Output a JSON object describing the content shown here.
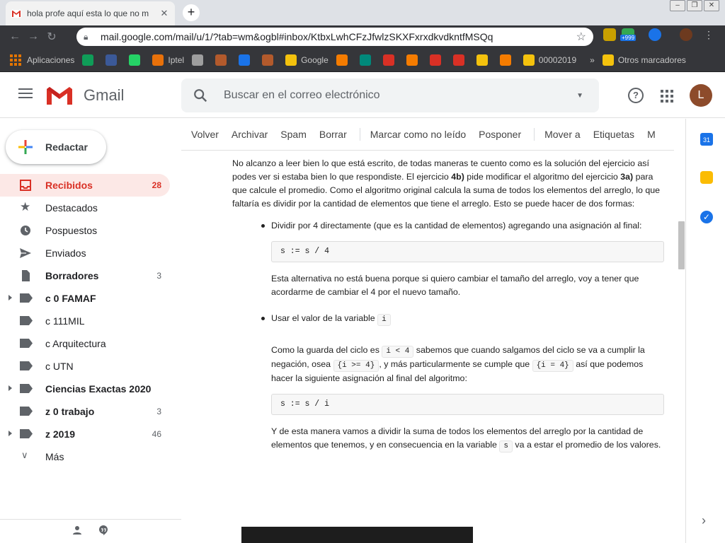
{
  "browser": {
    "tab_title": "hola profe aquí esta lo que no m",
    "tab_close": "✕",
    "new_tab": "+",
    "url": "mail.google.com/mail/u/1/?tab=wm&ogbl#inbox/KtbxLwhCFzJfwlzSKXFxrxdkvdkntfMSQq",
    "ext_badge": "+999",
    "bookmarks": [
      {
        "label": "Aplicaciones",
        "color": "#e37400"
      },
      {
        "label": "",
        "color": "#0f9d58"
      },
      {
        "label": "",
        "color": "#3b5998"
      },
      {
        "label": "",
        "color": "#25d366"
      },
      {
        "label": "Iptel",
        "color": "#e8710a"
      },
      {
        "label": "",
        "color": "#9e9e9e"
      },
      {
        "label": "",
        "color": "#b35a2c"
      },
      {
        "label": "",
        "color": "#1a73e8"
      },
      {
        "label": "",
        "color": "#b35a2c"
      },
      {
        "label": "Google",
        "color": "#f4c20d"
      },
      {
        "label": "",
        "color": "#f57c00"
      },
      {
        "label": "",
        "color": "#00897b"
      },
      {
        "label": "",
        "color": "#d93025"
      },
      {
        "label": "",
        "color": "#f57c00"
      },
      {
        "label": "",
        "color": "#d93025"
      },
      {
        "label": "",
        "color": "#d93025"
      },
      {
        "label": "",
        "color": "#f4c20d"
      },
      {
        "label": "",
        "color": "#f57c00"
      },
      {
        "label": "00002019",
        "color": "#f4c20d"
      }
    ],
    "bookmarks_more": "»",
    "other_bookmarks": "Otros marcadores"
  },
  "gmail": {
    "brand": "Gmail",
    "search_placeholder": "Buscar en el correo electrónico",
    "help": "?",
    "avatar_initial": "L",
    "compose": "Redactar",
    "nav": [
      {
        "label": "Recibidos",
        "count": "28"
      },
      {
        "label": "Destacados",
        "count": ""
      },
      {
        "label": "Pospuestos",
        "count": ""
      },
      {
        "label": "Enviados",
        "count": ""
      },
      {
        "label": "Borradores",
        "count": "3"
      },
      {
        "label": "c 0 FAMAF",
        "count": ""
      },
      {
        "label": "c 111MIL",
        "count": ""
      },
      {
        "label": "c Arquitectura",
        "count": ""
      },
      {
        "label": "c UTN",
        "count": ""
      },
      {
        "label": "Ciencias Exactas 2020",
        "count": ""
      },
      {
        "label": "z 0 trabajo",
        "count": "3"
      },
      {
        "label": "z 2019",
        "count": "46"
      },
      {
        "label": "Más",
        "count": ""
      }
    ],
    "actions": [
      "Volver",
      "Archivar",
      "Spam",
      "Borrar",
      "Marcar como no leído",
      "Posponer",
      "Mover a",
      "Etiquetas",
      "M"
    ],
    "side_apps": {
      "calendar_day": "31"
    }
  },
  "message": {
    "intro_a": "No alcanzo a leer bien lo que está escrito, de todas maneras te cuento como es la solución del ejercicio así podes ver si estaba bien lo que respondiste. El ejercicio ",
    "intro_b1": "4b)",
    "intro_c": " pide modificar el algoritmo del ejercicio ",
    "intro_b2": "3a)",
    "intro_d": " para que calcule el promedio. Como el algoritmo original calcula la suma de todos los elementos del arreglo, lo que faltaría es dividir por la cantidad de elementos que tiene el arreglo. Esto se puede hacer de dos formas:",
    "bullet1": "Dividir por 4 directamente (que es la cantidad de elementos) agregando una asignación al final:",
    "code1": "s := s / 4",
    "after1": "Esta alternativa no está buena porque si quiero cambiar el tamaño del arreglo, voy a tener que acordarme de cambiar el 4 por el nuevo tamaño.",
    "bullet2": "Usar el valor de la variable ",
    "bullet2_code": "i",
    "guard_a": "Como la guarda del ciclo es ",
    "guard_code1": "i < 4",
    "guard_b": " sabemos que cuando salgamos del ciclo se va a cumplir la negación, osea ",
    "guard_code2": "{i >= 4}",
    "guard_c": ", y más particularmente se cumple que ",
    "guard_code3": "{i = 4}",
    "guard_d": " así que podemos hacer la siguiente asignación al final del algoritmo:",
    "code2": "s := s / i",
    "final_a": "Y de esta manera vamos a dividir la suma de todos los elementos del arreglo por la cantidad de elementos que tenemos, y en consecuencia en la variable ",
    "final_code": "s",
    "final_b": " va a estar el promedio de los valores."
  },
  "colors": {
    "accent": "#d93025",
    "active_bg": "#fce8e6"
  }
}
